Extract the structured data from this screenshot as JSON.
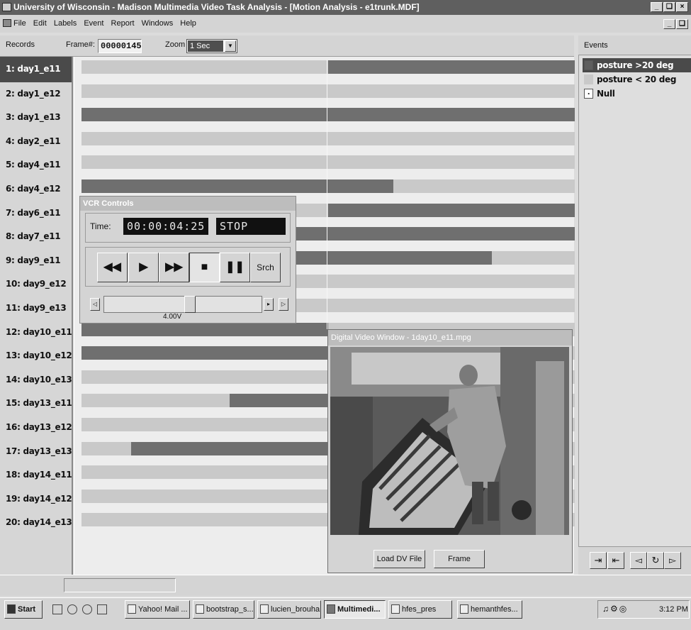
{
  "window": {
    "title": "University of Wisconsin - Madison    Multimedia Video Task Analysis - [Motion Analysis - e1trunk.MDF]",
    "controls": [
      "_",
      "❑",
      "×"
    ]
  },
  "menu": [
    "File",
    "Edit",
    "Labels",
    "Event",
    "Report",
    "Windows",
    "Help"
  ],
  "toolbar": {
    "records_label": "Records",
    "frame_label": "Frame#:",
    "frame_value": "00000145",
    "zoom_label": "Zoom",
    "zoom_value": "1 Sec"
  },
  "records": [
    "1: day1_e11",
    "2: day1_e12",
    "3: day1_e13",
    "4: day2_e11",
    "5: day4_e11",
    "6: day4_e12",
    "7: day6_e11",
    "8: day7_e11",
    "9: day9_e11",
    "10: day9_e12",
    "11: day9_e13",
    "12: day10_e11",
    "13: day10_e12",
    "14: day10_e13",
    "15: day13_e11",
    "16: day13_e12",
    "17: day13_e13",
    "18: day14_e11",
    "19: day14_e12",
    "20: day14_e13"
  ],
  "selected_record": 0,
  "timeline": {
    "note": "dark segments mark 'posture >20 deg', as fractions of the visible time window",
    "dark_segments": [
      [
        [
          0.5,
          1.0
        ]
      ],
      [],
      [
        [
          0.0,
          1.0
        ]
      ],
      [],
      [],
      [
        [
          0.0,
          0.632
        ]
      ],
      [
        [
          0.5,
          1.0
        ]
      ],
      [
        [
          0.0,
          1.0
        ]
      ],
      [
        [
          0.0,
          0.832
        ]
      ],
      [],
      [],
      [
        [
          0.0,
          0.5
        ]
      ],
      [
        [
          0.0,
          0.5
        ]
      ],
      [],
      [
        [
          0.3,
          0.5
        ]
      ],
      [],
      [
        [
          0.1,
          0.5
        ]
      ],
      [],
      [],
      []
    ],
    "colors": {
      "lane": "#c9c9c9",
      "event": "#6f6f6f"
    }
  },
  "events": {
    "header": "Events",
    "items": [
      {
        "label": "posture >20 deg",
        "swatch": "#5e5e5e",
        "marker": ""
      },
      {
        "label": "posture < 20 deg",
        "swatch": "#c9c9c9",
        "marker": ""
      },
      {
        "label": "Null",
        "swatch": "#ffffff",
        "marker": "."
      }
    ],
    "tools": [
      "insert-event-icon",
      "remove-event-icon",
      "arrow-left-icon",
      "refresh-icon",
      "arrow-right-icon"
    ]
  },
  "vcr": {
    "title": "VCR Controls",
    "time_label": "Time:",
    "time_value": "00:00:04:25",
    "state": "STOP",
    "buttons": {
      "rewind": "◀◀",
      "play": "▶",
      "fast_forward": "▶▶",
      "stop": "■",
      "pause": "❚❚",
      "search": "Srch"
    },
    "speed_label": "4.00V"
  },
  "video": {
    "title": "Digital Video Window - 1day10_e11.mpg",
    "load_button": "Load DV File",
    "frame_button": "Frame"
  },
  "taskbar": {
    "start": "Start",
    "tasks": [
      "Yahoo! Mail ...",
      "bootstrap_s...",
      "lucien_brouha",
      "Multimedi...",
      "hfes_pres",
      "hemanthfes..."
    ],
    "active_task": "Multimedi...",
    "clock": "3:12 PM"
  }
}
